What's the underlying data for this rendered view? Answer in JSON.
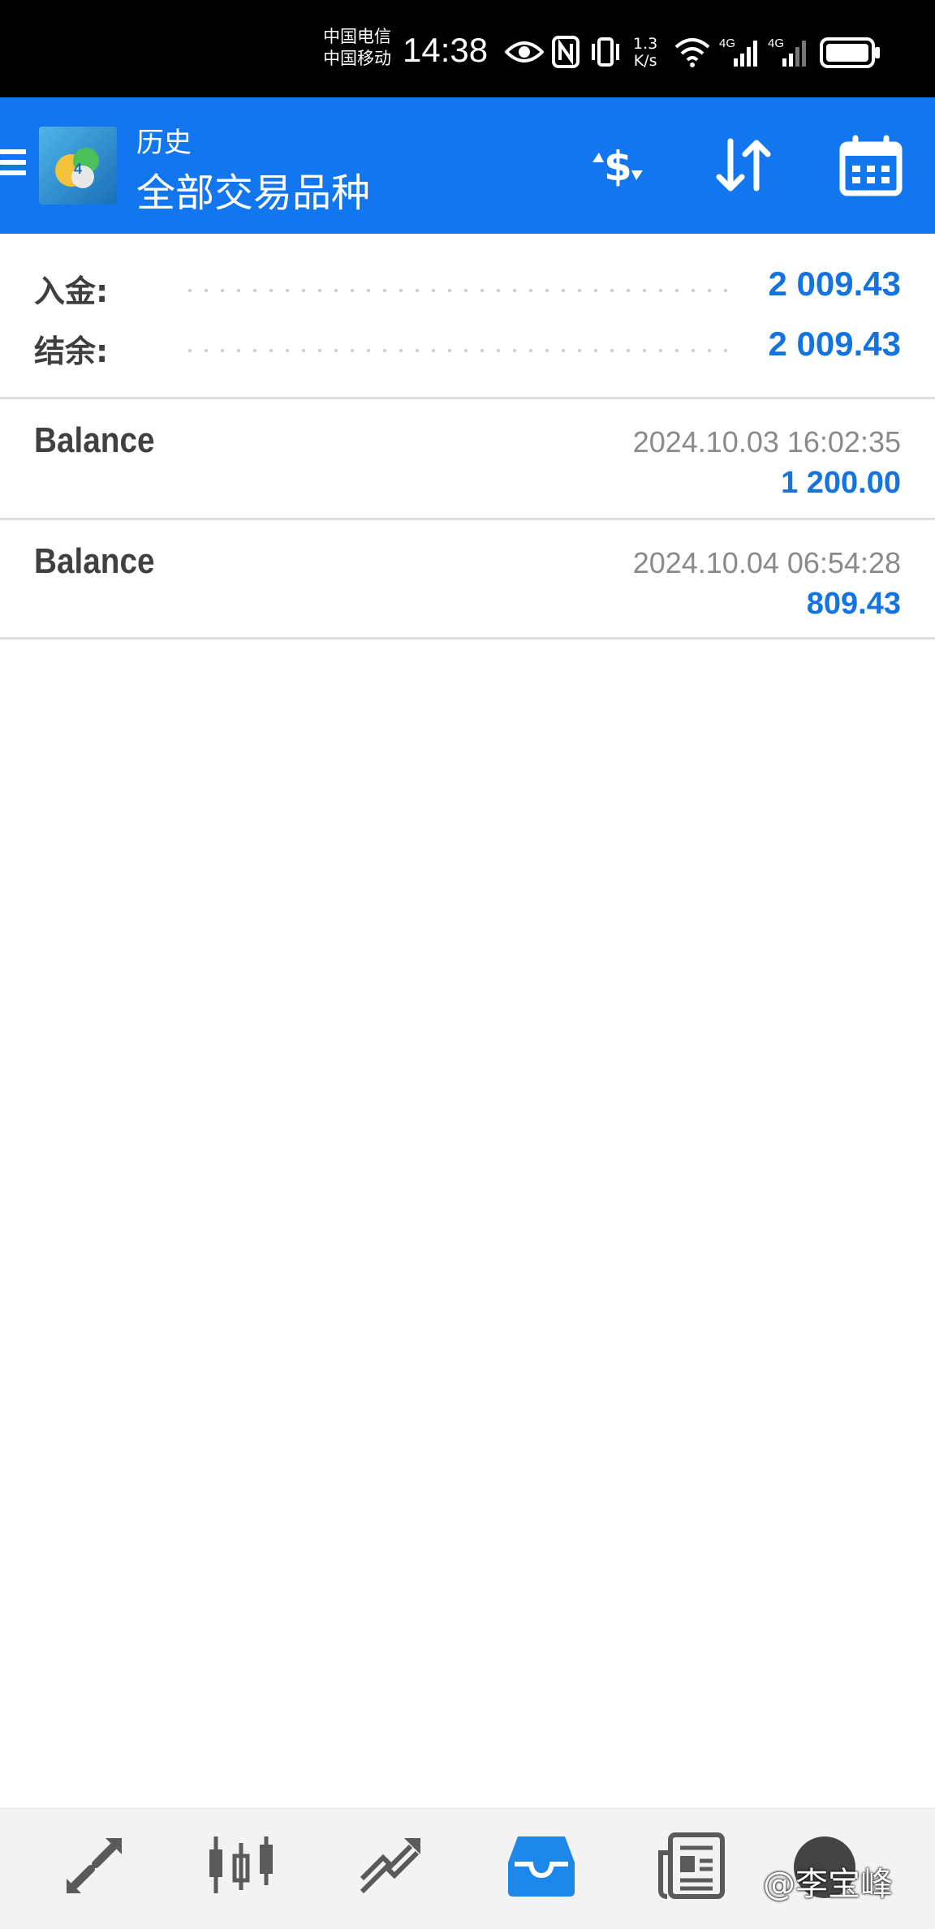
{
  "status_bar": {
    "carrier_1": "中国电信",
    "carrier_2": "中国移动",
    "time": "14:38",
    "net_speed_value": "1.3",
    "net_speed_unit": "K/s",
    "signal_1": "4G",
    "signal_2": "4G",
    "icons": [
      "eye-icon",
      "nfc-icon",
      "vibrate-icon",
      "wifi-icon",
      "signal-icon",
      "battery-icon"
    ]
  },
  "header": {
    "title": "历史",
    "subtitle": "全部交易品种",
    "actions": [
      "dollar-refresh-icon",
      "sort-icon",
      "calendar-icon"
    ]
  },
  "summary": {
    "deposit_label": "入金:",
    "deposit_value": "2 009.43",
    "balance_label": "结余:",
    "balance_value": "2 009.43"
  },
  "deals": [
    {
      "type": "Balance",
      "time": "2024.10.03 16:02:35",
      "amount": "1 200.00"
    },
    {
      "type": "Balance",
      "time": "2024.10.04 06:54:28",
      "amount": "809.43"
    }
  ],
  "bottom_nav": {
    "items": [
      "quotes-icon",
      "chart-icon",
      "trade-icon",
      "history-icon",
      "news-icon",
      "chat-icon"
    ],
    "active": "history-icon"
  },
  "watermark": "@李宝峰",
  "colors": {
    "accent": "#1277ef",
    "value_blue": "#1373e0",
    "status_bar": "#000000"
  }
}
